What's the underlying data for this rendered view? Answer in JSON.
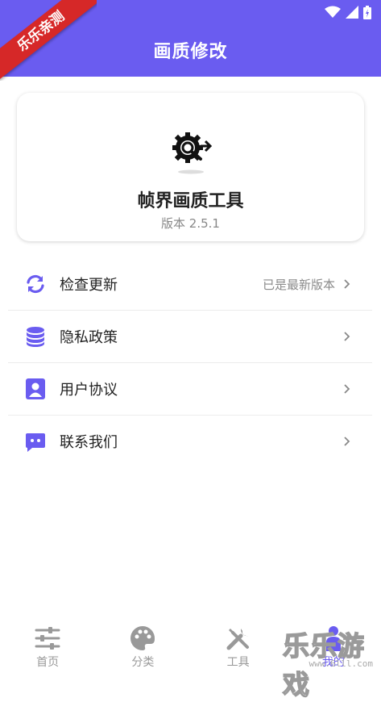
{
  "colors": {
    "accent": "#6a5cf0",
    "ribbon": "#d62828"
  },
  "header": {
    "title": "画质修改",
    "ribbon_text": "乐乐亲测"
  },
  "status_bar": {
    "icons": [
      "wifi-icon",
      "signal-icon",
      "battery-icon"
    ]
  },
  "app_card": {
    "name": "帧界画质工具",
    "version": "版本 2.5.1",
    "logo_icon": "gear-wrench-icon"
  },
  "menu": {
    "items": [
      {
        "label": "检查更新",
        "value": "已是最新版本",
        "icon": "refresh-icon"
      },
      {
        "label": "隐私政策",
        "value": "",
        "icon": "database-icon"
      },
      {
        "label": "用户协议",
        "value": "",
        "icon": "user-card-icon"
      },
      {
        "label": "联系我们",
        "value": "",
        "icon": "chat-icon"
      }
    ]
  },
  "bottom_nav": {
    "items": [
      {
        "label": "首页",
        "icon": "sliders-icon"
      },
      {
        "label": "分类",
        "icon": "palette-icon"
      },
      {
        "label": "工具",
        "icon": "tools-icon"
      },
      {
        "label": "我的",
        "icon": "person-icon",
        "active": true
      }
    ]
  },
  "watermark": {
    "big": "乐乐游戏",
    "small": "www.6lll.com"
  }
}
